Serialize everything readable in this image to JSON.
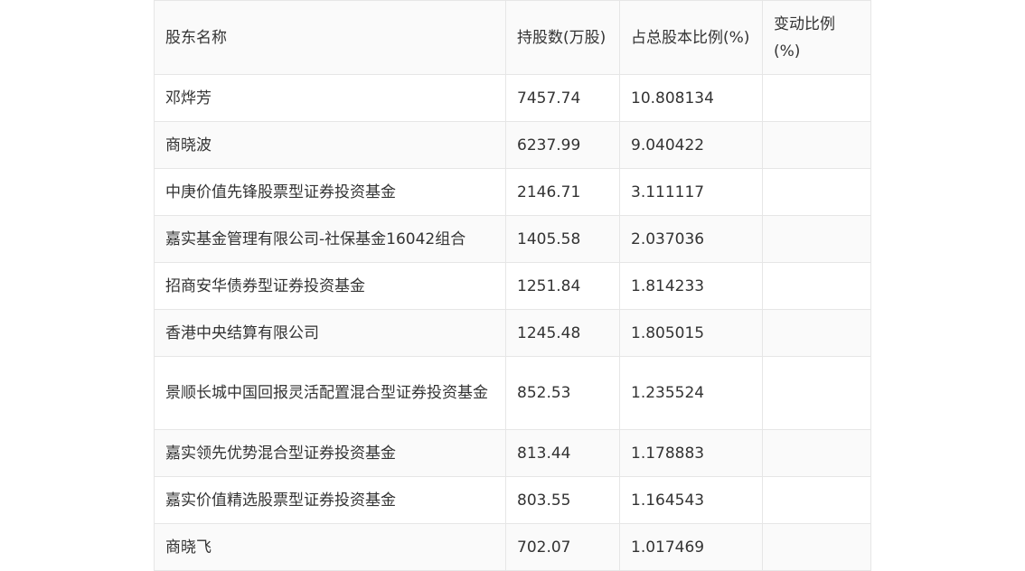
{
  "table": {
    "headers": {
      "name": "股东名称",
      "shares": "持股数(万股)",
      "ratio": "占总股本比例(%)",
      "change": "变动比例(%)"
    },
    "rows": [
      {
        "name": "邓烨芳",
        "shares": "7457.74",
        "ratio": "10.808134",
        "change": ""
      },
      {
        "name": "商晓波",
        "shares": "6237.99",
        "ratio": "9.040422",
        "change": ""
      },
      {
        "name": "中庚价值先锋股票型证券投资基金",
        "shares": "2146.71",
        "ratio": "3.111117",
        "change": ""
      },
      {
        "name": "嘉实基金管理有限公司-社保基金16042组合",
        "shares": "1405.58",
        "ratio": "2.037036",
        "change": ""
      },
      {
        "name": "招商安华债券型证券投资基金",
        "shares": "1251.84",
        "ratio": "1.814233",
        "change": ""
      },
      {
        "name": "香港中央结算有限公司",
        "shares": "1245.48",
        "ratio": "1.805015",
        "change": ""
      },
      {
        "name": "景顺长城中国回报灵活配置混合型证券投资基金",
        "shares": "852.53",
        "ratio": "1.235524",
        "change": ""
      },
      {
        "name": "嘉实领先优势混合型证券投资基金",
        "shares": "813.44",
        "ratio": "1.178883",
        "change": ""
      },
      {
        "name": "嘉实价值精选股票型证券投资基金",
        "shares": "803.55",
        "ratio": "1.164543",
        "change": ""
      },
      {
        "name": "商晓飞",
        "shares": "702.07",
        "ratio": "1.017469",
        "change": ""
      }
    ]
  }
}
